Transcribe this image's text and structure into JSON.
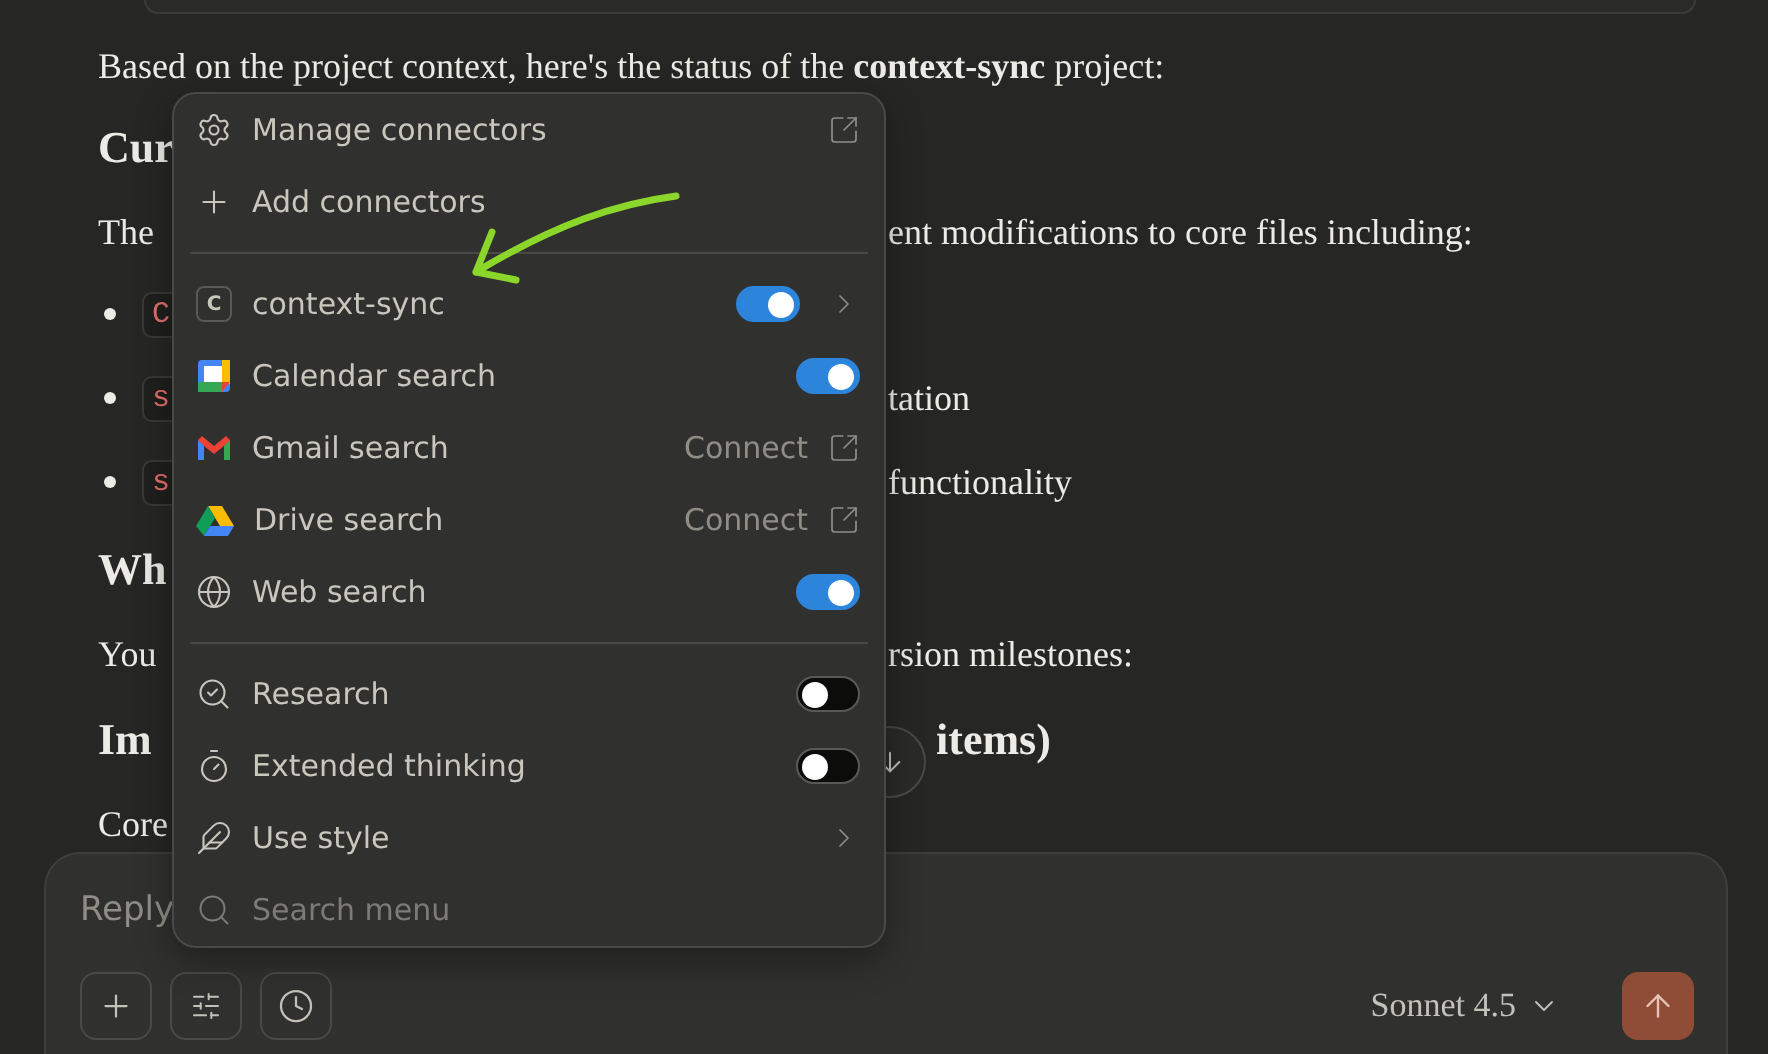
{
  "conversation": {
    "intro": "Based on the project context, here's the status of the **context-sync** project:",
    "lines": [
      {
        "kind": "heading",
        "left": "Cur"
      },
      {
        "kind": "text",
        "left": "The",
        "right": "ent modifications to core files including:"
      },
      {
        "kind": "bullet",
        "code": "C"
      },
      {
        "kind": "bullet",
        "code": "s",
        "right": "tation"
      },
      {
        "kind": "bullet",
        "code": "s",
        "right": "functionality"
      },
      {
        "kind": "heading",
        "left": "Wh"
      },
      {
        "kind": "text",
        "left": "You",
        "right": "rsion milestones:"
      },
      {
        "kind": "heading",
        "left": "Im",
        "right": "items)"
      },
      {
        "kind": "text",
        "left": "Core"
      }
    ]
  },
  "menu": {
    "groups": [
      [
        {
          "kind": "link",
          "label": "Manage connectors",
          "external": true
        },
        {
          "kind": "link",
          "label": "Add connectors",
          "external": false
        }
      ],
      [
        {
          "kind": "toggle",
          "label": "context-sync",
          "badge": "C",
          "on": true,
          "submenu": true
        },
        {
          "kind": "toggle",
          "label": "Calendar search",
          "on": true,
          "submenu": false
        },
        {
          "kind": "connect",
          "label": "Gmail search",
          "action": "Connect"
        },
        {
          "kind": "connect",
          "label": "Drive search",
          "action": "Connect"
        },
        {
          "kind": "toggle",
          "label": "Web search",
          "on": true,
          "submenu": false
        }
      ],
      [
        {
          "kind": "toggle",
          "label": "Research",
          "on": false,
          "submenu": false
        },
        {
          "kind": "toggle",
          "label": "Extended thinking",
          "on": false,
          "submenu": false
        },
        {
          "kind": "link",
          "label": "Use style",
          "external": false,
          "submenu": true
        }
      ]
    ],
    "search": {
      "placeholder": "Search menu"
    }
  },
  "composer": {
    "placeholder": "Reply",
    "model": "Sonnet 4.5"
  }
}
